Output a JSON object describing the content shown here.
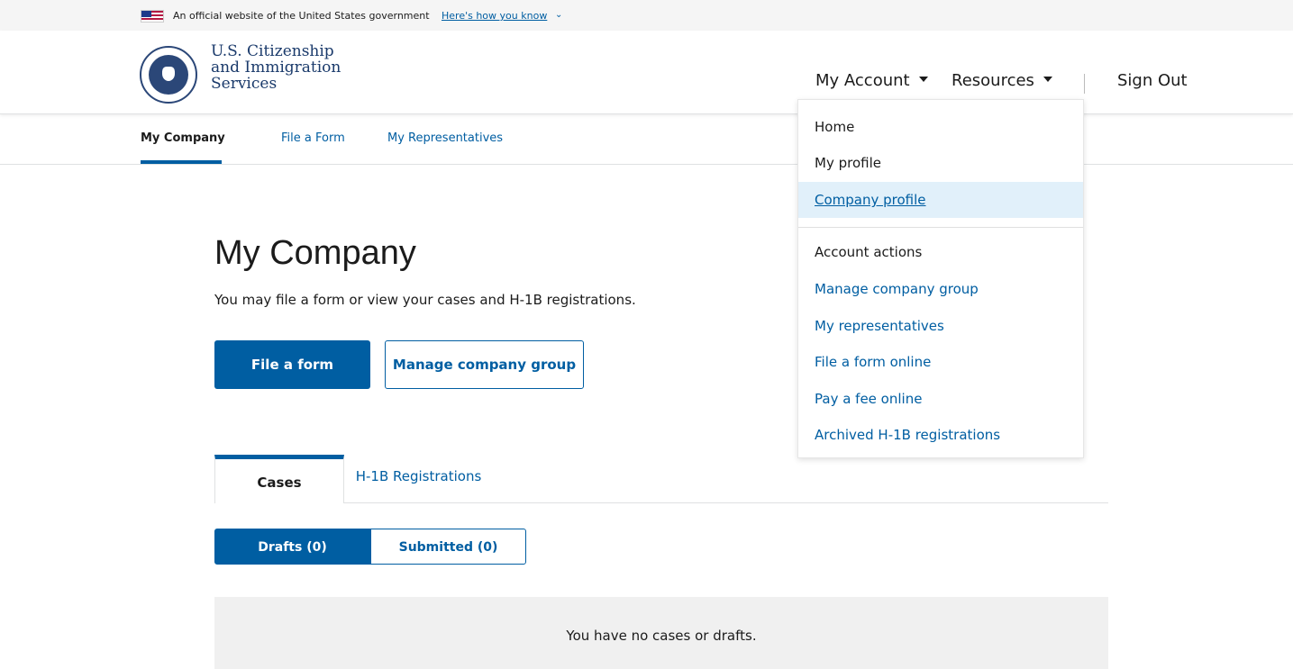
{
  "gov_banner": {
    "text": "An official website of the United States government",
    "link": "Here's how you know",
    "chevron": "⌄"
  },
  "logo": {
    "line1": "U.S. Citizenship",
    "line2": "and Immigration",
    "line3": "Services"
  },
  "top_nav": {
    "my_account": "My Account",
    "resources": "Resources",
    "sign_out": "Sign Out"
  },
  "sub_nav": {
    "items": [
      "My Company",
      "File a Form",
      "My Representatives"
    ]
  },
  "main": {
    "title": "My Company",
    "subtitle": "You may file a form or  view your cases and H-1B registrations.",
    "file_form_button": "File a form",
    "manage_group_button": "Manage company group",
    "tabs": [
      "Cases",
      "H-1B Registrations"
    ],
    "segments": [
      "Drafts (0)",
      "Submitted (0)"
    ],
    "empty_message": "You have no cases or drafts."
  },
  "dropdown": {
    "items": [
      "Home",
      "My profile",
      "Company profile"
    ],
    "heading": "Account actions",
    "actions": [
      "Manage company group",
      "My representatives",
      "File a form online",
      "Pay a fee online",
      "Archived H-1B registrations"
    ]
  },
  "colors": {
    "primary": "#005ea2",
    "selected_bg": "#e1f0fa",
    "empty_bg": "#f0f0f0"
  }
}
